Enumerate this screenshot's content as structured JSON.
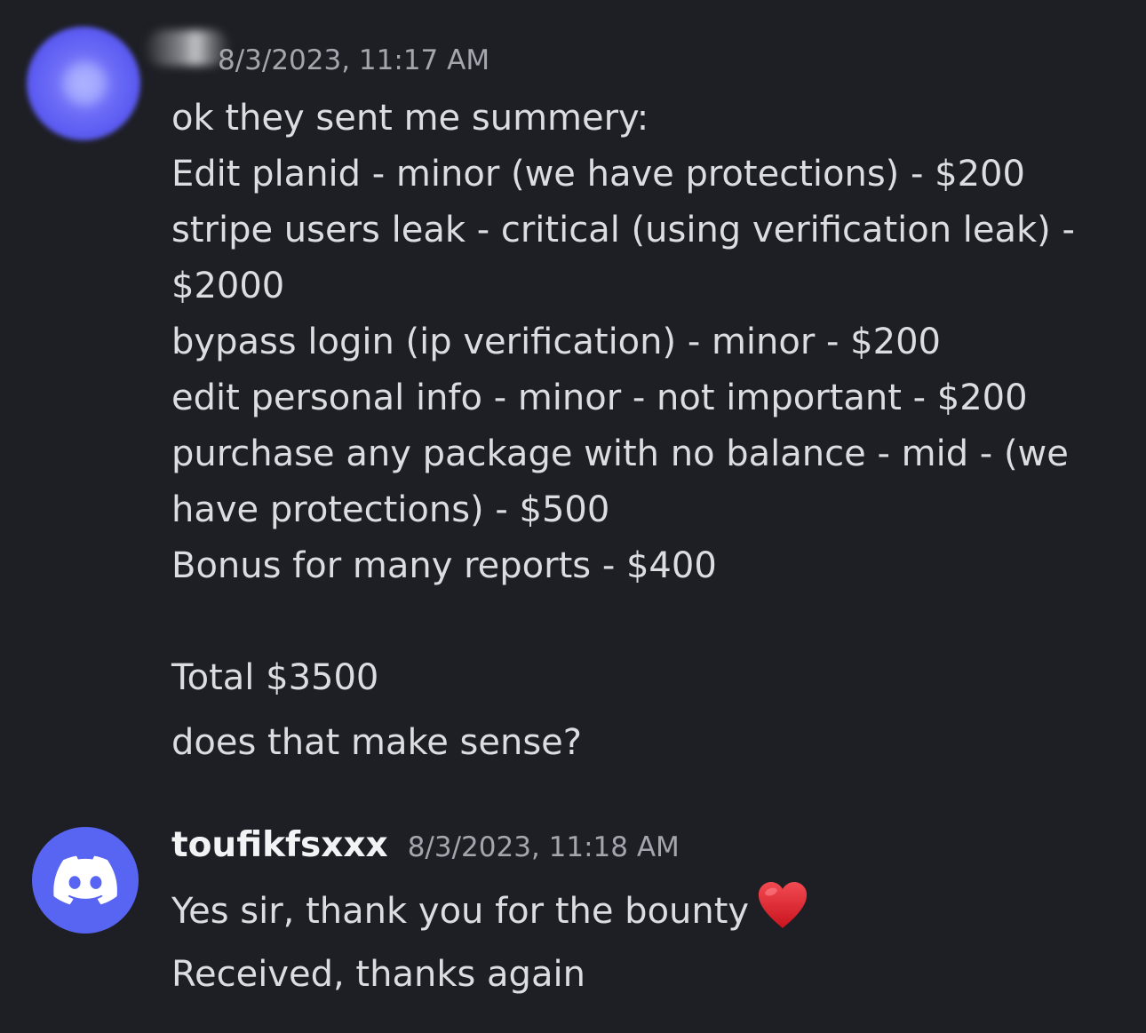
{
  "messages": [
    {
      "username": "",
      "timestamp": "8/3/2023, 11:17 AM",
      "avatar": "blurred-avatar",
      "lines": [
        "ok they sent me summery:",
        "Edit planid - minor (we have protections) - $200",
        "stripe users leak - critical (using verification leak) -",
        "$2000",
        "bypass login (ip verification) - minor - $200",
        "edit personal info - minor - not important - $200",
        "purchase any package with no balance - mid - (we",
        "have protections) - $500",
        "Bonus for many reports - $400"
      ],
      "total": "Total $3500",
      "question": "does that make sense?"
    },
    {
      "username": "toufikfsxxx",
      "timestamp": "8/3/2023, 11:18 AM",
      "avatar": "discord-logo-icon",
      "avatar_color": "#5865f2",
      "lines": [
        "Yes sir, thank you for the bounty",
        "Received, thanks again"
      ],
      "emoji": "heart-icon",
      "emoji_color": "#e0242f"
    }
  ],
  "colors": {
    "background": "#1e1f25",
    "text": "#dcdde1",
    "timestamp": "#a3a6ad",
    "username": "#f2f3f5"
  }
}
